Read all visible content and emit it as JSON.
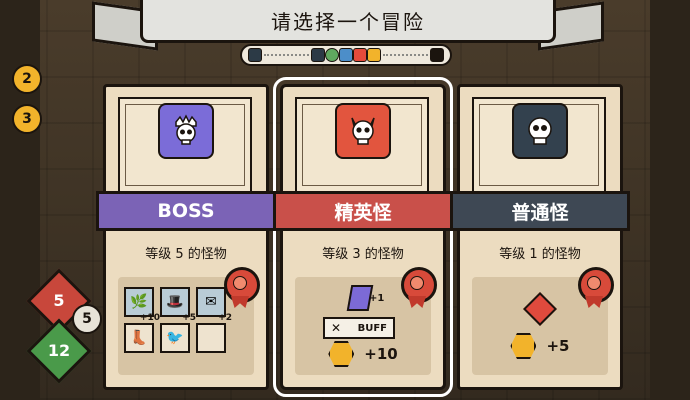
{
  "title": "请选择一个冒险",
  "side_left": [
    "2",
    "3",
    "5",
    "5",
    "12"
  ],
  "colors": {
    "boss": "#7b63b6",
    "elite": "#c9504a",
    "normal": "#3e4854",
    "boss_tile": "#7b6cd8",
    "elite_tile": "#e2553e",
    "normal_tile": "#33414e"
  },
  "cards": [
    {
      "name": "BOSS",
      "icon": "crowned-skull-icon",
      "level_text": "等级 5 的怪物",
      "rewards": {
        "items": [
          {
            "icon": "leaf-icon",
            "bonus": "+10"
          },
          {
            "icon": "hat-icon",
            "bonus": "+5"
          },
          {
            "icon": "envelope-icon",
            "bonus": "+2"
          },
          {
            "icon": "boots-icon",
            "bonus": ""
          },
          {
            "icon": "bird-icon",
            "bonus": ""
          },
          {
            "icon": "empty-slot",
            "bonus": ""
          }
        ]
      }
    },
    {
      "name": "精英怪",
      "icon": "horned-skull-icon",
      "level_text": "等级 3 的怪物",
      "selected": true,
      "rewards": {
        "upgrade_badge": "+1",
        "buff_label": "BUFF",
        "gold": "+10"
      }
    },
    {
      "name": "普通怪",
      "icon": "skull-icon",
      "level_text": "等级 1 的怪物",
      "rewards": {
        "gold": "+5"
      }
    }
  ]
}
